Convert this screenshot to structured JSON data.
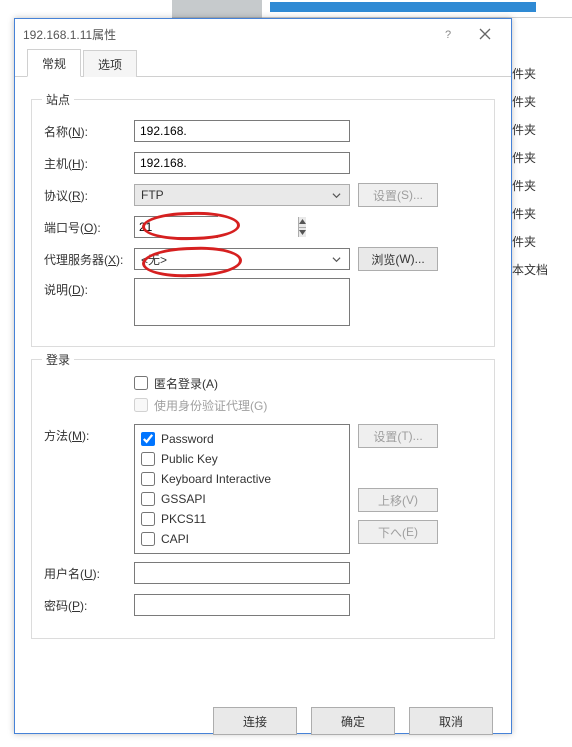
{
  "dialog": {
    "title": "192.168.1.11属性"
  },
  "tabs": {
    "general": "常规",
    "options": "选项"
  },
  "site": {
    "legend": "站点",
    "name_label_pre": "名称(",
    "name_label_u": "N",
    "name_label_post": "):",
    "name_value": "192.168.",
    "host_label_pre": "主机(",
    "host_label_u": "H",
    "host_label_post": "):",
    "host_value": "192.168.",
    "proto_label_pre": "协议(",
    "proto_label_u": "R",
    "proto_label_post": "):",
    "proto_value": "FTP",
    "proto_settings_pre": "设置(",
    "proto_settings_u": "S",
    "proto_settings_post": ")...",
    "port_label_pre": "端口号(",
    "port_label_u": "O",
    "port_label_post": "):",
    "port_value": "21",
    "proxy_label_pre": "代理服务器(",
    "proxy_label_u": "X",
    "proxy_label_post": "):",
    "proxy_value": "<无>",
    "proxy_browse_pre": "浏览(",
    "proxy_browse_u": "W",
    "proxy_browse_post": ")...",
    "desc_label_pre": "说明(",
    "desc_label_u": "D",
    "desc_label_post": "):"
  },
  "login": {
    "legend": "登录",
    "anon_pre": "匿名登录(",
    "anon_u": "A",
    "anon_post": ")",
    "proxy_pre": "使用身份验证代理(",
    "proxy_u": "G",
    "proxy_post": ")",
    "method_label_pre": "方法(",
    "method_label_u": "M",
    "method_label_post": "):",
    "methods": [
      {
        "label": "Password",
        "checked": true
      },
      {
        "label": "Public Key",
        "checked": false
      },
      {
        "label": "Keyboard Interactive",
        "checked": false
      },
      {
        "label": "GSSAPI",
        "checked": false
      },
      {
        "label": "PKCS11",
        "checked": false
      },
      {
        "label": "CAPI",
        "checked": false
      }
    ],
    "method_settings_pre": "设置(",
    "method_settings_u": "T",
    "method_settings_post": ")...",
    "move_up_pre": "上移(",
    "move_up_u": "V",
    "move_up_post": ")",
    "move_down_pre": "下へ(",
    "move_down_u": "E",
    "move_down_post": ")",
    "move_down_display_pre": "下へ(",
    "move_down_correct_pre": "下へ",
    "move_down2_pre": "下ヘ",
    "movedown_pre": "下へ(",
    "move_down_label_pre": "下へ(",
    "user_label_pre": "用户名(",
    "user_label_u": "U",
    "user_label_post": "):",
    "user_value": "",
    "pass_label_pre": "密码(",
    "pass_label_u": "P",
    "pass_label_post": "):",
    "pass_value": ""
  },
  "buttons": {
    "connect": "连接",
    "ok": "确定",
    "cancel": "取消"
  },
  "bg_list": [
    "件夹",
    "件夹",
    "件夹",
    "件夹",
    "件夹",
    "件夹",
    "件夹",
    "本文档"
  ]
}
